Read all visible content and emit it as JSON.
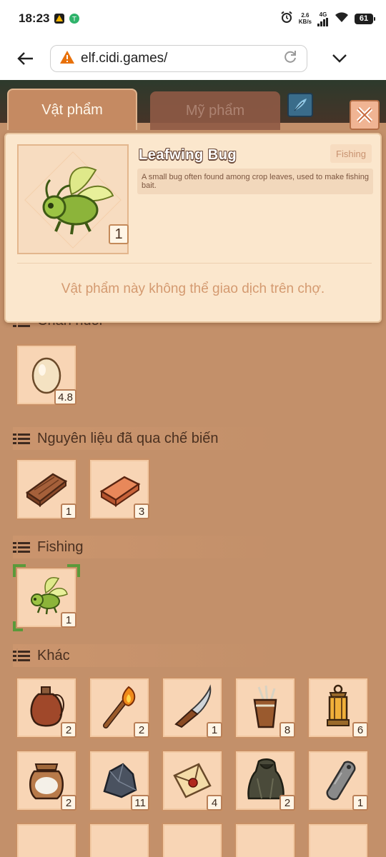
{
  "status_bar": {
    "time": "18:23",
    "net_speed_value": "2.6",
    "net_speed_unit": "KB/s",
    "net_type": "4G",
    "battery": "61"
  },
  "browser": {
    "url": "elf.cidi.games/"
  },
  "tabs": [
    {
      "label": "Vật phẩm",
      "active": true
    },
    {
      "label": "Mỹ phẩm",
      "active": false
    }
  ],
  "detail": {
    "name": "Leafwing Bug",
    "category_tag": "Fishing",
    "description": "A small bug often found among crop leaves, used to make fishing bait.",
    "quantity": "1",
    "note": "Vật phẩm này không thể giao dịch trên chợ."
  },
  "inventory": {
    "partial_category": "Chăn nuôi",
    "categories": [
      {
        "title": "Nguyên liệu đã qua chế biến"
      },
      {
        "title": "Fishing"
      },
      {
        "title": "Khác"
      }
    ],
    "items": {
      "egg": {
        "icon": "egg-icon",
        "qty": "4.8"
      },
      "wood_plank": {
        "icon": "wood-plank-icon",
        "qty": "1"
      },
      "brick": {
        "icon": "brick-icon",
        "qty": "3"
      },
      "leafwing_bug": {
        "icon": "leafwing-bug-icon",
        "qty": "1"
      },
      "leather_flask": {
        "icon": "leather-flask-icon",
        "qty": "2"
      },
      "torch": {
        "icon": "torch-icon",
        "qty": "2"
      },
      "knife": {
        "icon": "knife-icon",
        "qty": "1"
      },
      "quiver": {
        "icon": "quiver-icon",
        "qty": "8"
      },
      "lantern": {
        "icon": "lantern-icon",
        "qty": "6"
      },
      "salt_jar": {
        "icon": "salt-jar-icon",
        "qty": "2"
      },
      "stone": {
        "icon": "stone-icon",
        "qty": "11"
      },
      "letter": {
        "icon": "letter-icon",
        "qty": "4"
      },
      "cloak": {
        "icon": "cloak-icon",
        "qty": "2"
      },
      "metal_tag": {
        "icon": "metal-tag-icon",
        "qty": "1"
      }
    }
  },
  "colors": {
    "panel_bg": "#c3906a",
    "slot_bg": "#f8d5b5",
    "popup_bg": "#fbe7cd",
    "accent_green": "#5a9a3a"
  }
}
